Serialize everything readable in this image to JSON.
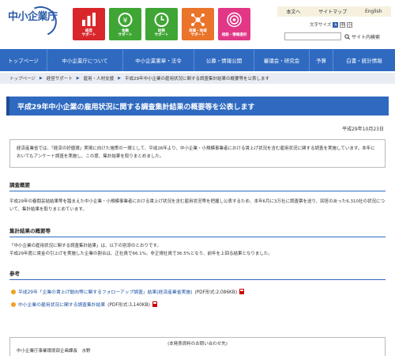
{
  "header": {
    "logo_text": "中小企業庁",
    "tiles": [
      {
        "label": "経営\nサポート",
        "color": "#d9262b"
      },
      {
        "label": "金融\nサポート",
        "color": "#3fa535"
      },
      {
        "label": "財務\nサポート",
        "color": "#3fa535"
      },
      {
        "label": "商業・地域\nサポート",
        "color": "#e9742a"
      },
      {
        "label": "相談・情報提供",
        "color": "#e23787"
      }
    ],
    "util_links": [
      "本文へ",
      "サイトマップ",
      "English"
    ],
    "font_size_label": "文字サイズ",
    "font_size_options": [
      "大",
      "中",
      "小"
    ],
    "font_size_selected": "大",
    "search_placeholder": "",
    "search_button": "サイト内検索"
  },
  "nav": {
    "items": [
      "トップページ",
      "中小企業庁について",
      "中小企業憲章・法令",
      "公募・情報公開",
      "審議会・研究会",
      "予算",
      "白書・統計情報"
    ]
  },
  "breadcrumb": [
    "トップページ",
    "経営サポート",
    "雇用・人材支援",
    "平成29年中小企業の雇用状況に関する調査集計結果の概要等を公表します"
  ],
  "page": {
    "title": "平成29年中小企業の雇用状況に関する調査集計結果の概要等を公表します",
    "date": "平成29年10月23日",
    "intro": "経済産業省では、「経済の好循環」実現に向けた施策の一環として、平成26年より、中小企業・小規模事業者における賃上げ状況を含む雇用状況に関する調査を実施しています。本年においてもアンケート調査を実施し、この度、集計結果を取りまとめました。"
  },
  "sections": {
    "overview": {
      "heading": "調査概要",
      "body": "平成29年の春闘妥結結果等を踏まえた中小企業・小規模事業者における賃上げ状況を含む雇用状況等を把握し公表するため、本年6月に3万社に調査票を送り、回答のあった6,310社の状況について、集計結果を取りまとめています。"
    },
    "results": {
      "heading": "集計結果の概要等",
      "body1": "「中小企業の雇用状況に関する調査集計結果」は、以下の別添のとおりです。",
      "body2": "平成29年度に賃金の引上げを実施した企業の割合は、正社員で66.1%、非正規社員で36.5%となり、前年を上回る結果となりました。"
    },
    "reference": {
      "heading": "参考",
      "items": [
        {
          "link": "平成29年「企業の賃上げ動向等に関するフォローアップ調査」結果(経済産業省実施)",
          "meta": "(PDF形式:2,086KB)"
        },
        {
          "link": "中小企業の雇用状況に関する調査集計結果",
          "meta": "(PDF形式:3,140KB)"
        }
      ]
    }
  },
  "contact": {
    "heading": "(本発表資料のお問い合わせ先)",
    "line1": "中小企業庁事業環境部企画課長　水野"
  }
}
